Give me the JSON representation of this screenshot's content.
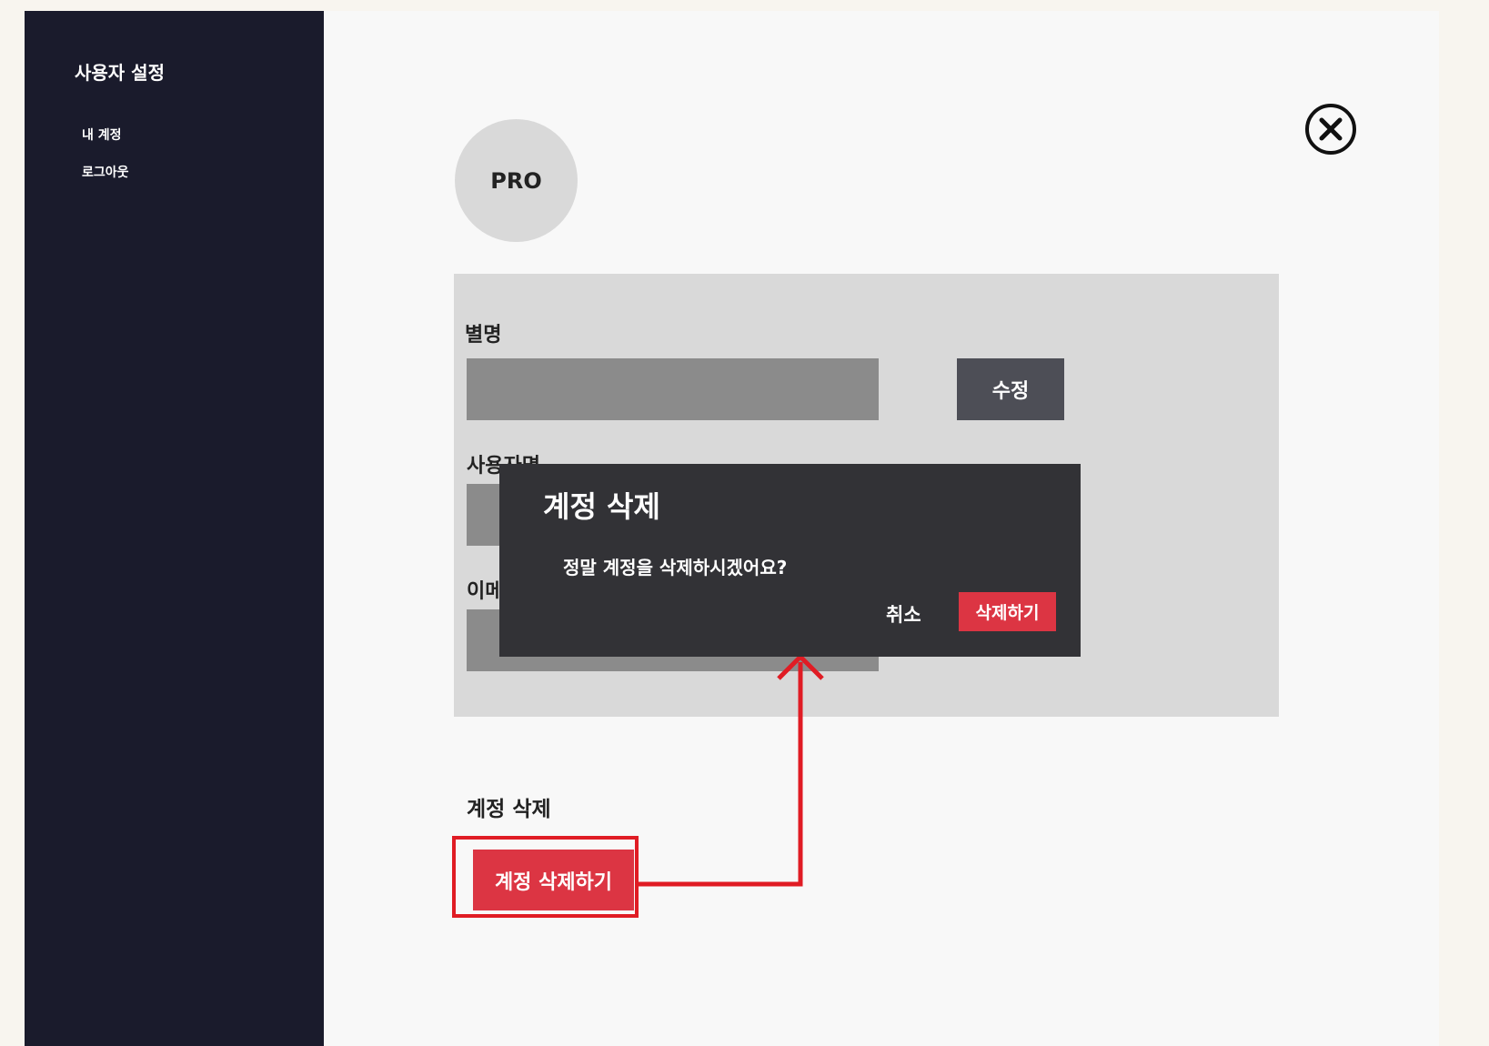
{
  "sidebar": {
    "title": "사용자 설정",
    "items": [
      {
        "label": "내 계정"
      },
      {
        "label": "로그아웃"
      }
    ]
  },
  "profile": {
    "avatar_text": "PRO"
  },
  "fields": [
    {
      "label": "별명",
      "value": ""
    },
    {
      "label": "사용자명",
      "value": ""
    },
    {
      "label": "이메일",
      "value": ""
    }
  ],
  "edit_button": {
    "label": "수정"
  },
  "delete_section": {
    "title": "계정 삭제",
    "button_label": "계정 삭제하기"
  },
  "modal": {
    "title": "계정 삭제",
    "message": "정말 계정을 삭제하시겠어요?",
    "cancel_label": "취소",
    "confirm_label": "삭제하기"
  },
  "icons": {
    "close": "close-circle-icon"
  },
  "colors": {
    "sidebar_bg": "#1a1b2c",
    "danger": "#dc3543",
    "annotation_red": "#e01c24",
    "modal_bg": "#323236",
    "panel_bg": "#d9d9d9",
    "input_bg": "#8b8b8b",
    "button_dark": "#4d4e56"
  }
}
